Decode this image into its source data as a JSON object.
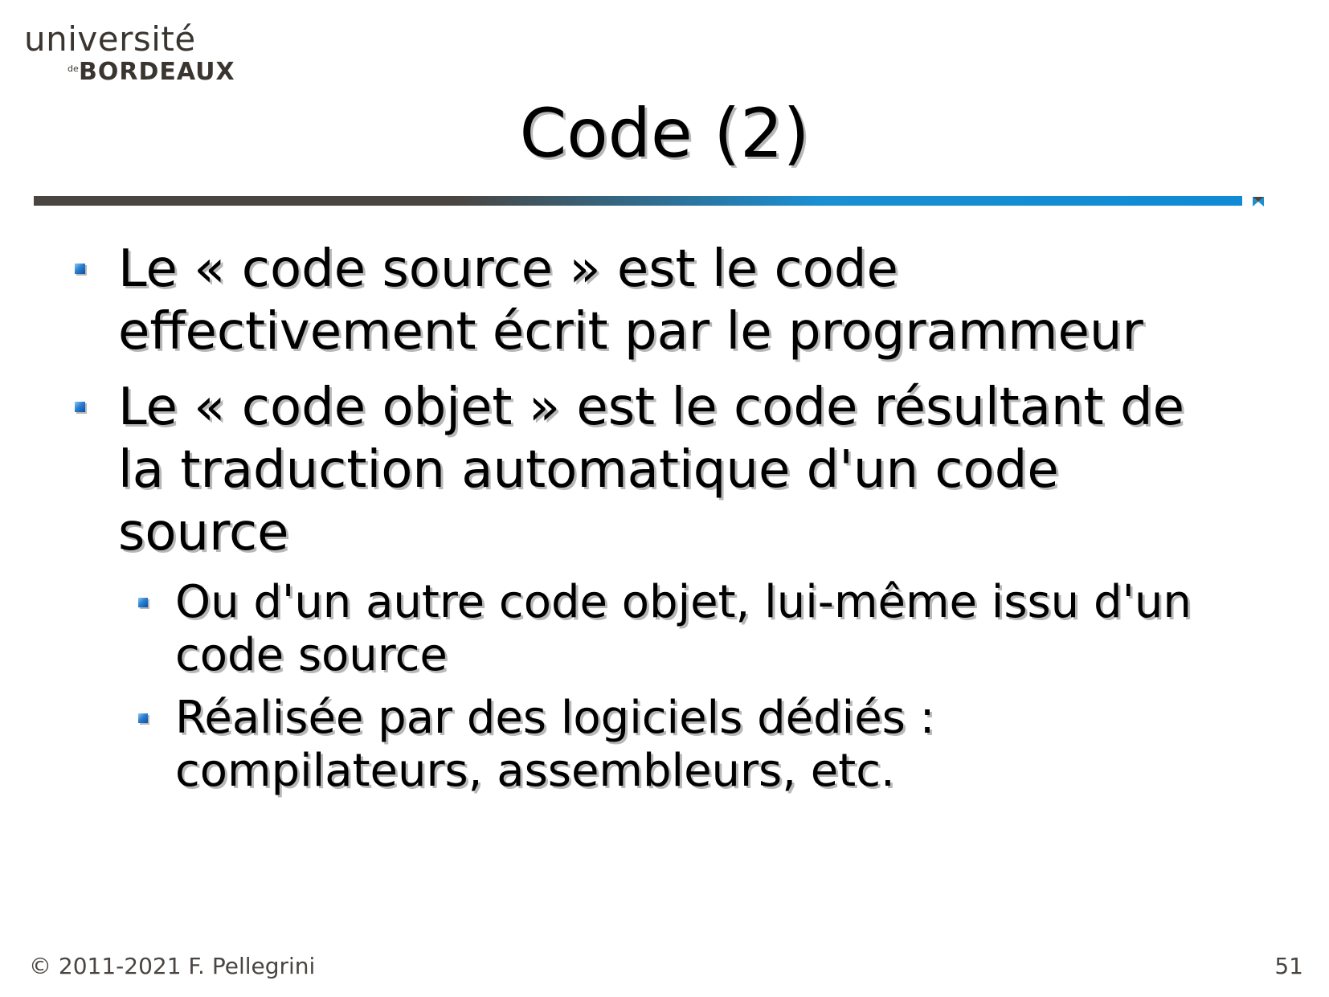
{
  "logo": {
    "line1": "université",
    "line2_small": "de",
    "line2": "BORDEAUX"
  },
  "slide": {
    "title": "Code (2)",
    "bullets": [
      {
        "text": "Le « code source » est le code effectivement écrit par le programmeur",
        "lines": [
          "Le « code source » est le code",
          "effectivement écrit par le programmeur"
        ]
      },
      {
        "text": "Le « code objet » est le code résultant de la traduction automatique d'un code source",
        "lines": [
          "Le « code objet » est le code résultant de",
          "la traduction automatique d'un code",
          "source"
        ],
        "sub_bullets": [
          {
            "lines": [
              "Ou d'un autre code objet, lui-même issu d'un",
              "code source"
            ]
          },
          {
            "lines": [
              "Réalisée par des logiciels dédiés :",
              "compilateurs, assembleurs, etc."
            ]
          }
        ]
      }
    ]
  },
  "footer": {
    "copyright": "© 2011-2021 F. Pellegrini",
    "page_number": "51"
  },
  "colors": {
    "text": "#000000",
    "shadow": "#b8b8b8",
    "rule_dark": "#4a4541",
    "rule_blue": "#1a8fd2",
    "bullet_blue": "#2c7fd0",
    "logo_text": "#3b3530"
  }
}
